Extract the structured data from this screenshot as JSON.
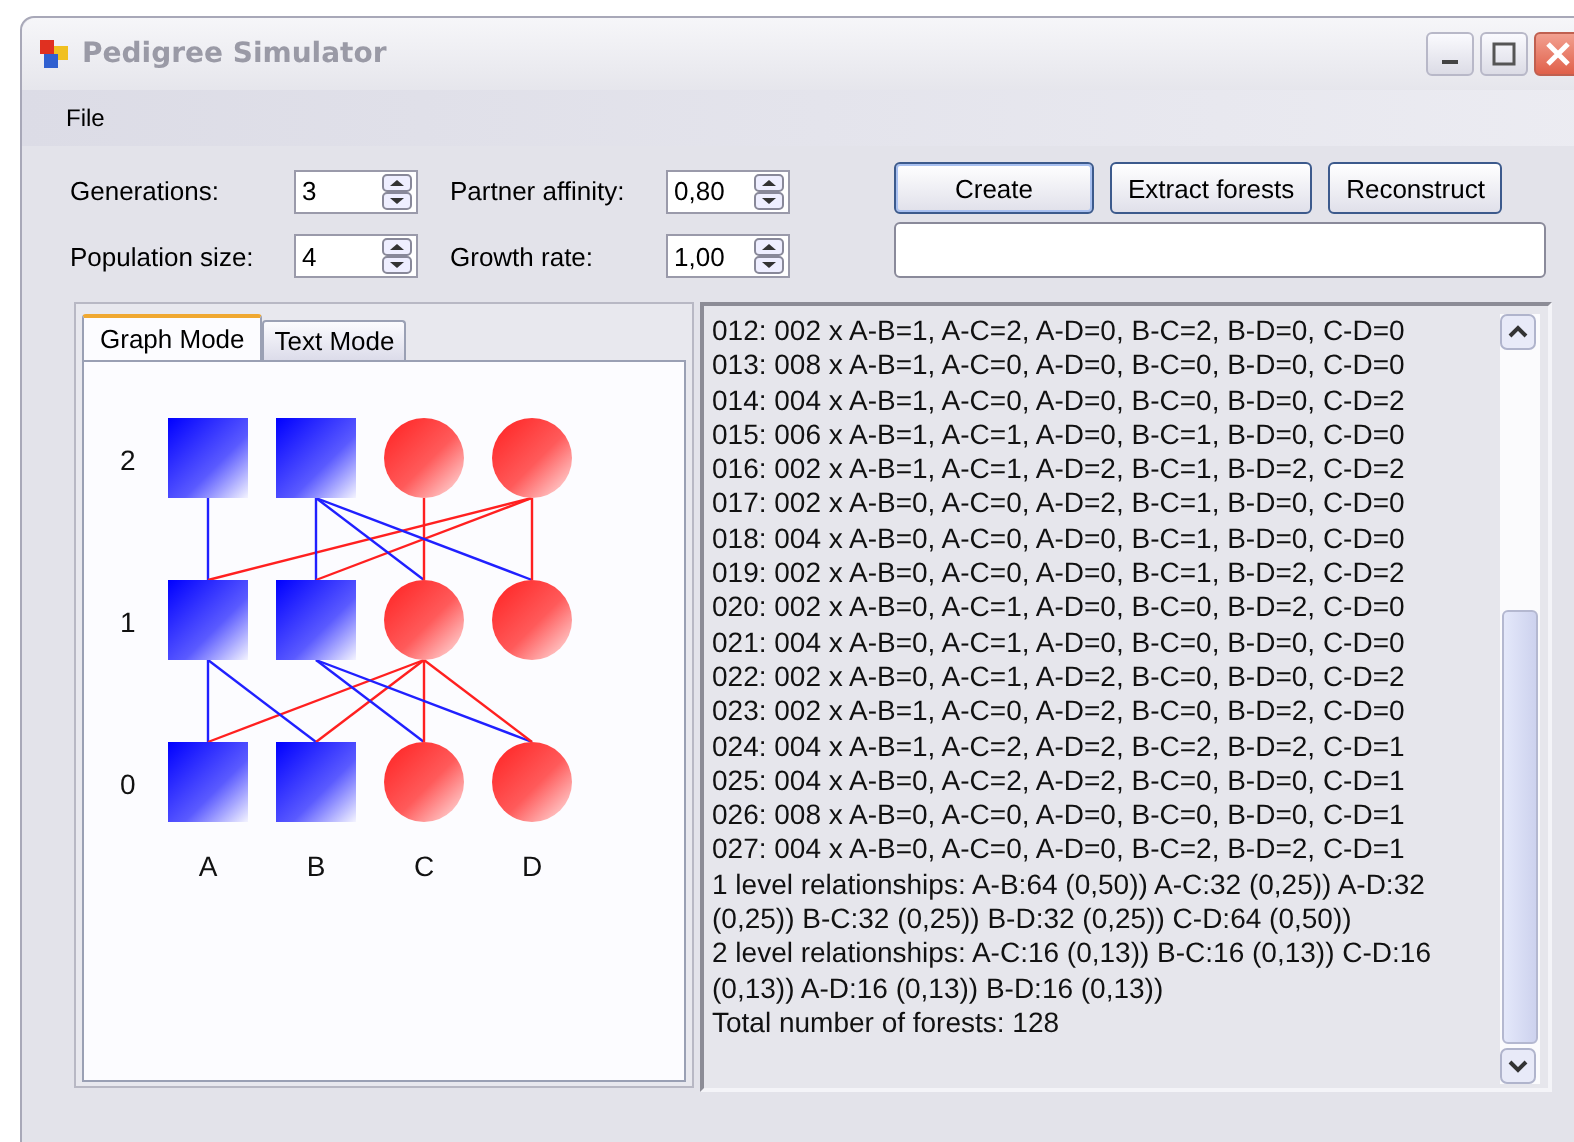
{
  "window": {
    "title": "Pedigree Simulator"
  },
  "menu": [
    "File"
  ],
  "settings": [
    {
      "label": "Generations:",
      "value": "3"
    },
    {
      "label": "Partner affinity:",
      "value": "0,80"
    },
    {
      "label": "Population size:",
      "value": "4"
    },
    {
      "label": "Growth rate:",
      "value": "1,00"
    }
  ],
  "buttons": [
    "Create",
    "Extract forests",
    "Reconstruct"
  ],
  "tabs": [
    {
      "label": "Graph Mode",
      "selected": true
    },
    {
      "label": "Text Mode",
      "selected": false
    }
  ],
  "graph": {
    "columns": [
      "A",
      "B",
      "C",
      "D"
    ],
    "generations": [
      {
        "label": "2",
        "nodes": [
          {
            "kind": "male"
          },
          {
            "kind": "male"
          },
          {
            "kind": "female"
          },
          {
            "kind": "female"
          }
        ]
      },
      {
        "label": "1",
        "nodes": [
          {
            "kind": "male"
          },
          {
            "kind": "male"
          },
          {
            "kind": "female"
          },
          {
            "kind": "female"
          }
        ]
      },
      {
        "label": "0",
        "nodes": [
          {
            "kind": "male"
          },
          {
            "kind": "male"
          },
          {
            "kind": "female"
          },
          {
            "kind": "female"
          }
        ]
      }
    ]
  },
  "output_lines": [
    "012: 002 x A-B=1, A-C=2, A-D=0, B-C=2, B-D=0, C-D=0",
    "013: 008 x A-B=1, A-C=0, A-D=0, B-C=0, B-D=0, C-D=0",
    "014: 004 x A-B=1, A-C=0, A-D=0, B-C=0, B-D=0, C-D=2",
    "015: 006 x A-B=1, A-C=1, A-D=0, B-C=1, B-D=0, C-D=0",
    "016: 002 x A-B=1, A-C=1, A-D=2, B-C=1, B-D=2, C-D=2",
    "017: 002 x A-B=0, A-C=0, A-D=2, B-C=1, B-D=0, C-D=0",
    "018: 004 x A-B=0, A-C=0, A-D=0, B-C=1, B-D=0, C-D=0",
    "019: 002 x A-B=0, A-C=0, A-D=0, B-C=1, B-D=2, C-D=2",
    "020: 002 x A-B=0, A-C=1, A-D=0, B-C=0, B-D=2, C-D=0",
    "021: 004 x A-B=0, A-C=1, A-D=0, B-C=0, B-D=0, C-D=0",
    "022: 002 x A-B=0, A-C=1, A-D=2, B-C=0, B-D=0, C-D=2",
    "023: 002 x A-B=1, A-C=0, A-D=2, B-C=0, B-D=2, C-D=0",
    "024: 004 x A-B=1, A-C=2, A-D=2, B-C=2, B-D=2, C-D=1",
    "025: 004 x A-B=0, A-C=2, A-D=2, B-C=0, B-D=0, C-D=1",
    "026: 008 x A-B=0, A-C=0, A-D=0, B-C=0, B-D=0, C-D=1",
    "027: 004 x A-B=0, A-C=0, A-D=0, B-C=2, B-D=2, C-D=1",
    "1 level relationships: A-B:64 (0,50)) A-C:32 (0,25)) A-D:32 (0,25)) B-C:32 (0,25)) B-D:32 (0,25)) C-D:64 (0,50))",
    "2 level relationships: A-C:16 (0,13)) B-C:16 (0,13)) C-D:16 (0,13)) A-D:16 (0,13)) B-D:16 (0,13))",
    "Total number of forests: 128"
  ]
}
